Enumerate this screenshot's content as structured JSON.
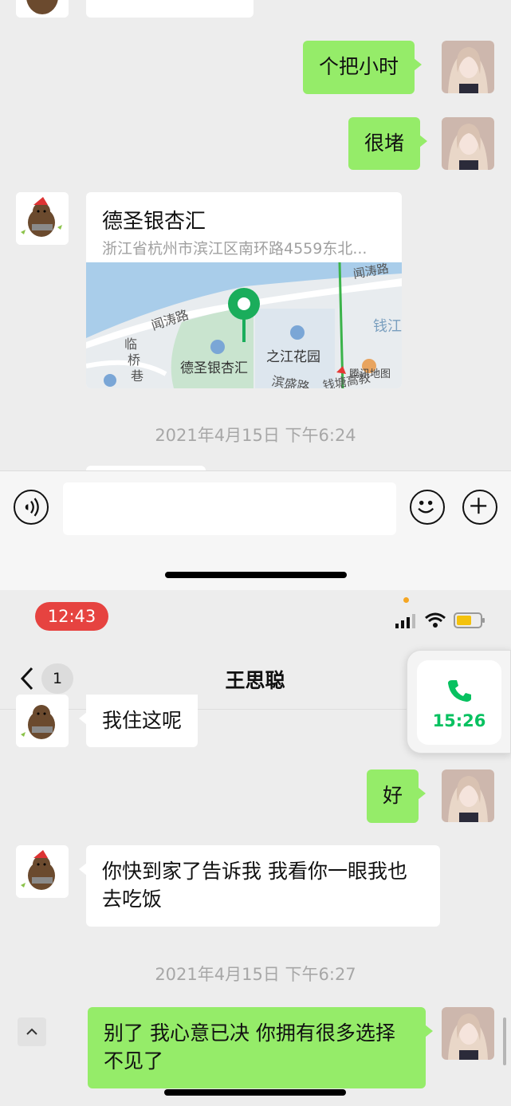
{
  "upper_chat": {
    "msg_outgoing_1": "个把小时",
    "msg_outgoing_2": "很堵",
    "location": {
      "title": "德圣银杏汇",
      "address": "浙江省杭州市滨江区南环路4559东北...",
      "map_labels": {
        "road_1": "闻涛路",
        "road_2": "闻涛路",
        "place_1": "之江花园",
        "place_2": "德圣银杏汇",
        "place_3": "钱江",
        "lane_1": "临",
        "lane_2": "桥",
        "lane_3": "巷",
        "road_3": "滨盛路",
        "road_4": "钱塘高教",
        "brand": "腾讯地图"
      }
    },
    "timestamp": "2021年4月15日 下午6:24"
  },
  "input_bar": {
    "voice_icon": "voice-icon",
    "emoji_icon": "emoji-icon",
    "plus_icon": "plus-icon"
  },
  "status_bar": {
    "time": "12:43",
    "time_pill_color": "#e64340"
  },
  "nav": {
    "unread_count": "1",
    "contact_name": "王思聪"
  },
  "call_widget": {
    "duration": "15:26",
    "color": "#07c160"
  },
  "lower_chat": {
    "msg_incoming_1": "我住这呢",
    "msg_outgoing_1": "好",
    "msg_incoming_2": "你快到家了告诉我 我看你一眼我也去吃饭",
    "timestamp": "2021年4月15日 下午6:27",
    "msg_outgoing_2": "别了 我心意已决 你拥有很多选择 不见了"
  },
  "colors": {
    "background": "#ededed",
    "green_bubble": "#95ec69",
    "white_bubble": "#ffffff"
  }
}
